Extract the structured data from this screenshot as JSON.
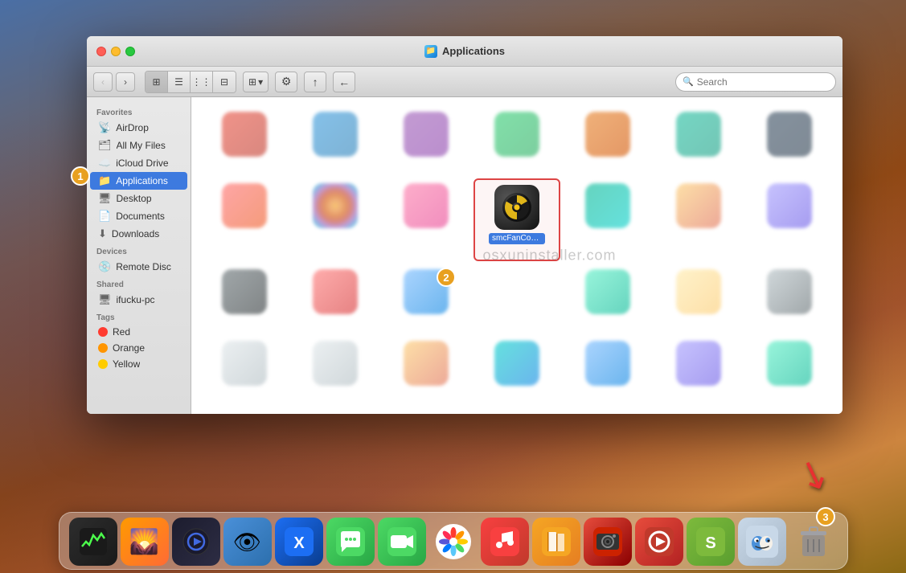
{
  "window": {
    "title": "Applications",
    "title_icon": "📁"
  },
  "toolbar": {
    "back_label": "‹",
    "forward_label": "›",
    "view_icon_label": "⊞",
    "view_list_label": "☰",
    "view_column_label": "⋮⋮",
    "view_cover_label": "⊟",
    "arrange_label": "⊞ ▾",
    "action_label": "⚙ ▾",
    "share_label": "↑",
    "path_label": "←",
    "search_placeholder": "Search"
  },
  "sidebar": {
    "favorites_label": "Favorites",
    "items": [
      {
        "id": "airdrop",
        "label": "AirDrop",
        "icon": "📡"
      },
      {
        "id": "all-my-files",
        "label": "All My Files",
        "icon": "🗂"
      },
      {
        "id": "icloud-drive",
        "label": "iCloud Drive",
        "icon": "☁️"
      },
      {
        "id": "applications",
        "label": "Applications",
        "icon": "📁",
        "active": true
      },
      {
        "id": "desktop",
        "label": "Desktop",
        "icon": "🖥"
      },
      {
        "id": "documents",
        "label": "Documents",
        "icon": "📄"
      },
      {
        "id": "downloads",
        "label": "Downloads",
        "icon": "⬇"
      }
    ],
    "devices_label": "Devices",
    "devices": [
      {
        "id": "remote-disc",
        "label": "Remote Disc",
        "icon": "💿"
      }
    ],
    "shared_label": "Shared",
    "shared_items": [
      {
        "id": "ifucku-pc",
        "label": "ifucku-pc",
        "icon": "🖥"
      }
    ],
    "tags_label": "Tags",
    "tags": [
      {
        "id": "red",
        "label": "Red",
        "color": "#ff3b30"
      },
      {
        "id": "orange",
        "label": "Orange",
        "color": "#ff9500"
      },
      {
        "id": "yellow",
        "label": "Yellow",
        "color": "#ffcc00"
      }
    ]
  },
  "content": {
    "watermark": "osxuninstaller.com",
    "selected_app": {
      "name": "smcFanControl",
      "label": "smcFanControl"
    }
  },
  "badges": {
    "step1": "1",
    "step2": "2",
    "step3": "3"
  },
  "dock": {
    "items": [
      {
        "id": "activity-monitor",
        "label": "Activity Monitor",
        "icon": "📊"
      },
      {
        "id": "photos-preview",
        "label": "Preview",
        "icon": "🖼"
      },
      {
        "id": "quicktime",
        "label": "QuickTime Player",
        "icon": "▶"
      },
      {
        "id": "preview",
        "label": "Preview",
        "icon": "👁"
      },
      {
        "id": "xcode",
        "label": "Xcode",
        "icon": "🔨"
      },
      {
        "id": "messages",
        "label": "Messages",
        "icon": "💬"
      },
      {
        "id": "facetime",
        "label": "FaceTime",
        "icon": "📞"
      },
      {
        "id": "photos",
        "label": "Photos",
        "icon": "🌸"
      },
      {
        "id": "music",
        "label": "Music",
        "icon": "🎵"
      },
      {
        "id": "books",
        "label": "Books",
        "icon": "📖"
      },
      {
        "id": "photobooth",
        "label": "Photo Booth",
        "icon": "📸"
      },
      {
        "id": "videopro",
        "label": "Video Pro",
        "icon": "🎬"
      },
      {
        "id": "sketchup",
        "label": "SketchUp",
        "icon": "📐"
      },
      {
        "id": "finder2",
        "label": "Finder",
        "icon": "🖥"
      },
      {
        "id": "trash",
        "label": "Trash",
        "icon": "🗑"
      }
    ]
  }
}
